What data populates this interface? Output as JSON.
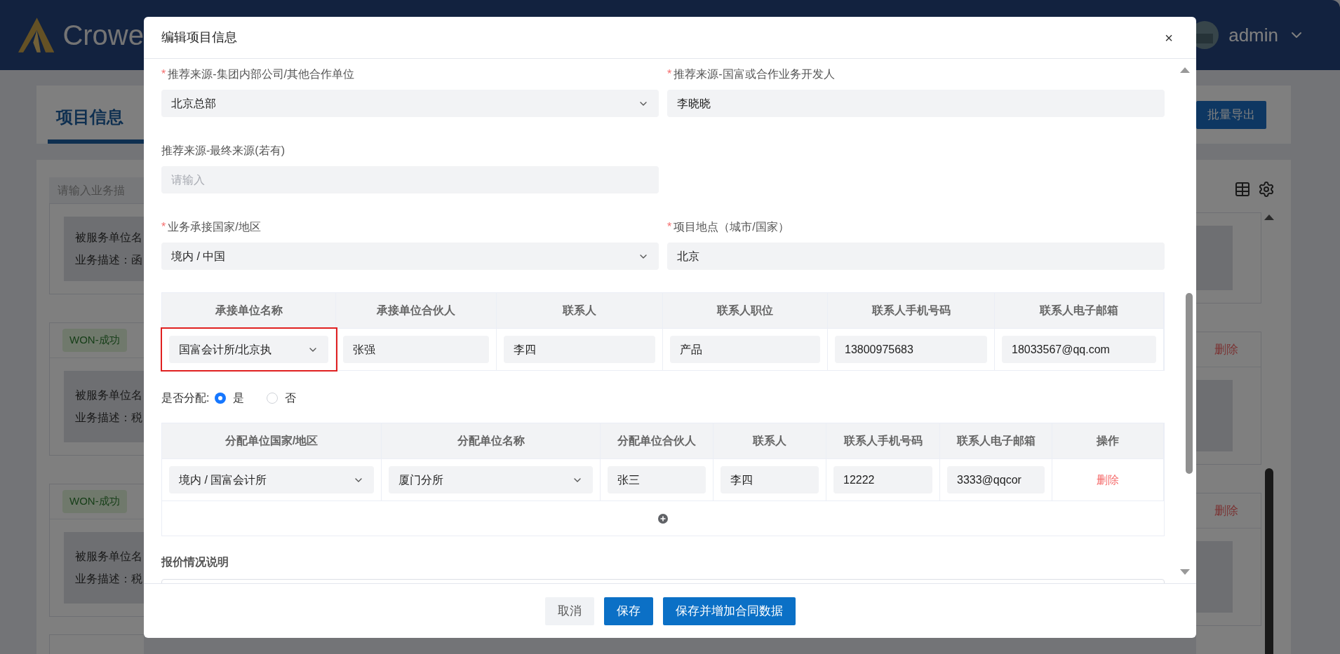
{
  "header": {
    "logo_text": "Crowe",
    "user": "admin"
  },
  "page": {
    "tab": "项目信息",
    "export_button": "批量导出",
    "search_placeholder": "请输入业务描",
    "cards": [
      {
        "line_1": "被服务单位名",
        "line_2": "业务描述：函"
      },
      {
        "tag": "WON-成功",
        "line_1": "被服务单位名",
        "line_2": "业务描述：税",
        "action": "删除"
      },
      {
        "tag": "WON-成功",
        "line_1": "被服务单位名",
        "line_2": "业务描述：税",
        "action": "删除"
      }
    ]
  },
  "dialog": {
    "title": "编辑项目信息",
    "close": "×",
    "fields": [
      {
        "label": "推荐来源-集团内部公司/其他合作单位",
        "mark": "*",
        "kind": "select",
        "value": "北京总部"
      },
      {
        "label": "推荐来源-国富或合作业务开发人",
        "mark": "*",
        "kind": "input",
        "value": "李晓晓"
      },
      {
        "label": "推荐来源-最终来源(若有)",
        "kind": "input",
        "placeholder": "请输入"
      },
      {
        "kind": "empty"
      },
      {
        "label": "业务承接国家/地区",
        "mark": "*",
        "kind": "select",
        "value": "境内 / 中国"
      },
      {
        "label": "项目地点（城市/国家）",
        "mark": "*",
        "kind": "input",
        "value": "北京"
      }
    ],
    "undertaking_table": {
      "columns": [
        "承接单位名称",
        "承接单位合伙人",
        "联系人",
        "联系人职位",
        "联系人手机号码",
        "联系人电子邮箱"
      ],
      "rows": [
        [
          {
            "kind": "select",
            "value": "国富会计所/北京执",
            "highlighted": true
          },
          {
            "kind": "input",
            "value": "张强"
          },
          {
            "kind": "input",
            "value": "李四"
          },
          {
            "kind": "input",
            "value": "产品"
          },
          {
            "kind": "input",
            "value": "13800975683"
          },
          {
            "kind": "input",
            "value": "18033567@qq.com"
          }
        ]
      ]
    },
    "allocate": {
      "label": "是否分配:",
      "options": [
        {
          "label": "是",
          "selected": true
        },
        {
          "label": "否",
          "selected": false
        }
      ]
    },
    "allocation_table": {
      "columns": [
        "分配单位国家/地区",
        "分配单位名称",
        "分配单位合伙人",
        "联系人",
        "联系人手机号码",
        "联系人电子邮箱",
        "操作"
      ],
      "rows": [
        [
          {
            "kind": "select",
            "value": "境内 / 国富会计所"
          },
          {
            "kind": "select",
            "value": "厦门分所"
          },
          {
            "kind": "input",
            "value": "张三"
          },
          {
            "kind": "input",
            "value": "李四"
          },
          {
            "kind": "input",
            "value": "12222"
          },
          {
            "kind": "input",
            "value": "3333@qqcor"
          },
          {
            "kind": "link",
            "value": "删除"
          }
        ]
      ]
    },
    "quote_label": "报价情况说明",
    "buttons": [
      {
        "label": "取消",
        "kind": "secondary"
      },
      {
        "label": "保存",
        "kind": "primary"
      },
      {
        "label": "保存并增加合同数据",
        "kind": "primary"
      }
    ]
  }
}
